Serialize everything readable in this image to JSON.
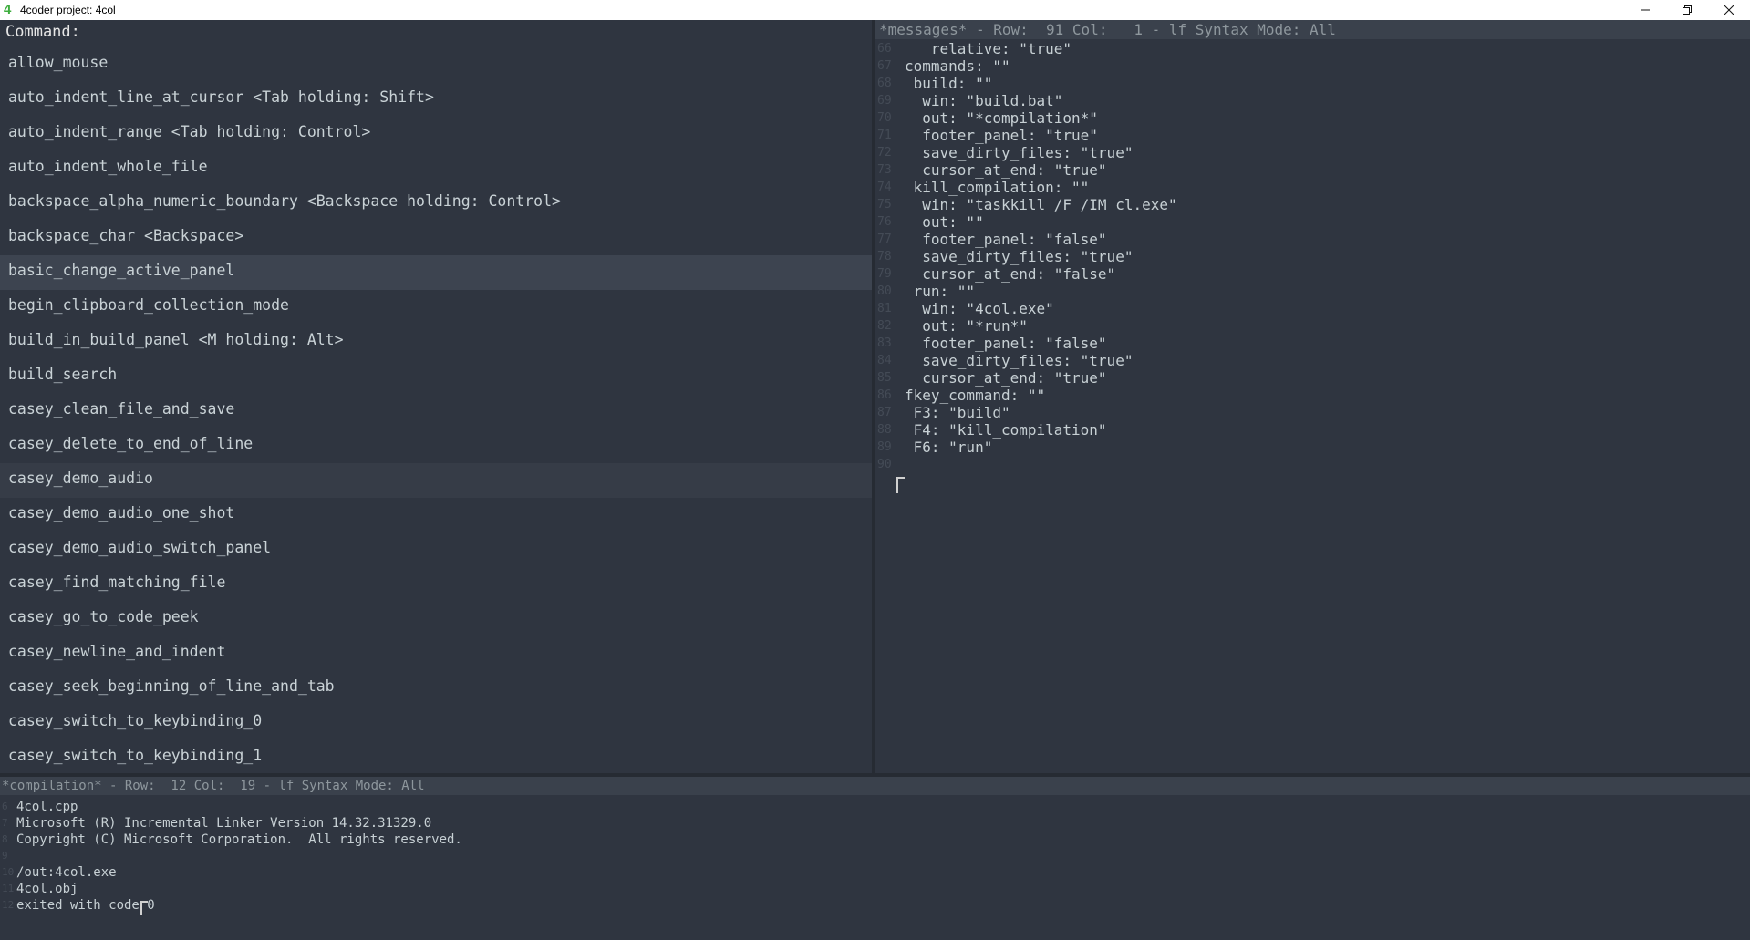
{
  "window": {
    "title": "4coder project: 4col",
    "app_icon_glyph": "4",
    "controls": [
      "minimize-icon",
      "restore-icon",
      "close-icon"
    ]
  },
  "command_panel": {
    "header": "Command:",
    "items": [
      "allow_mouse",
      "auto_indent_line_at_cursor <Tab holding: Shift>",
      "auto_indent_range <Tab holding: Control>",
      "auto_indent_whole_file",
      "backspace_alpha_numeric_boundary <Backspace holding: Control>",
      "backspace_char <Backspace>",
      "basic_change_active_panel",
      "begin_clipboard_collection_mode",
      "build_in_build_panel <M holding: Alt>",
      "build_search",
      "casey_clean_file_and_save",
      "casey_delete_to_end_of_line",
      "casey_demo_audio",
      "casey_demo_audio_one_shot",
      "casey_demo_audio_switch_panel",
      "casey_find_matching_file",
      "casey_go_to_code_peek",
      "casey_newline_and_indent",
      "casey_seek_beginning_of_line_and_tab",
      "casey_switch_to_keybinding_0",
      "casey_switch_to_keybinding_1"
    ]
  },
  "messages_panel": {
    "status": "*messages* - Row:  91 Col:   1 - lf Syntax Mode: All",
    "lines": [
      {
        "n": "66",
        "t": "   relative: \"true\""
      },
      {
        "n": "67",
        "t": "commands: \"\""
      },
      {
        "n": "68",
        "t": " build: \"\""
      },
      {
        "n": "69",
        "t": "  win: \"build.bat\""
      },
      {
        "n": "70",
        "t": "  out: \"*compilation*\""
      },
      {
        "n": "71",
        "t": "  footer_panel: \"true\""
      },
      {
        "n": "72",
        "t": "  save_dirty_files: \"true\""
      },
      {
        "n": "73",
        "t": "  cursor_at_end: \"true\""
      },
      {
        "n": "74",
        "t": " kill_compilation: \"\""
      },
      {
        "n": "75",
        "t": "  win: \"taskkill /F /IM cl.exe\""
      },
      {
        "n": "76",
        "t": "  out: \"\""
      },
      {
        "n": "77",
        "t": "  footer_panel: \"false\""
      },
      {
        "n": "78",
        "t": "  save_dirty_files: \"true\""
      },
      {
        "n": "79",
        "t": "  cursor_at_end: \"false\""
      },
      {
        "n": "80",
        "t": " run: \"\""
      },
      {
        "n": "81",
        "t": "  win: \"4col.exe\""
      },
      {
        "n": "82",
        "t": "  out: \"*run*\""
      },
      {
        "n": "83",
        "t": "  footer_panel: \"false\""
      },
      {
        "n": "84",
        "t": "  save_dirty_files: \"true\""
      },
      {
        "n": "85",
        "t": "  cursor_at_end: \"true\""
      },
      {
        "n": "86",
        "t": "fkey_command: \"\""
      },
      {
        "n": "87",
        "t": " F3: \"build\""
      },
      {
        "n": "88",
        "t": " F4: \"kill_compilation\""
      },
      {
        "n": "89",
        "t": " F6: \"run\""
      },
      {
        "n": "90",
        "t": ""
      }
    ]
  },
  "compilation_panel": {
    "status": "*compilation* - Row:  12 Col:  19 - lf Syntax Mode: All",
    "lines": [
      {
        "n": "6",
        "t": "4col.cpp"
      },
      {
        "n": "7",
        "t": "Microsoft (R) Incremental Linker Version 14.32.31329.0"
      },
      {
        "n": "8",
        "t": "Copyright (C) Microsoft Corporation.  All rights reserved."
      },
      {
        "n": "9",
        "t": ""
      },
      {
        "n": "10",
        "t": "/out:4col.exe"
      },
      {
        "n": "11",
        "t": "4col.obj"
      },
      {
        "n": "12",
        "t": "exited with code 0"
      }
    ]
  }
}
